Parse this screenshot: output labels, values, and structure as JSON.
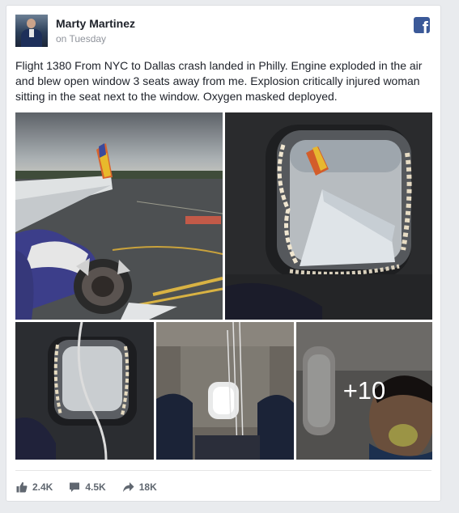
{
  "post": {
    "author": "Marty Martinez",
    "timestamp": "on Tuesday",
    "logo_letter": "f",
    "text": "Flight 1380 From NYC to Dallas crash landed in Philly. Engine exploded in the air and blew open window 3 seats away from me. Explosion critically injured woman sitting in the seat next to the window. Oxygen masked deployed."
  },
  "photos": {
    "more_count": "+10"
  },
  "stats": {
    "likes": "2.4K",
    "comments": "4.5K",
    "shares": "18K"
  },
  "icons": {
    "like": "thumbs-up-icon",
    "comment": "comment-bubble-icon",
    "share": "share-arrow-icon",
    "brand": "facebook-logo"
  },
  "colors": {
    "facebook_blue": "#3b5998",
    "author_text": "#1d2129",
    "meta_text": "#90949c",
    "stat_text": "#606770"
  }
}
